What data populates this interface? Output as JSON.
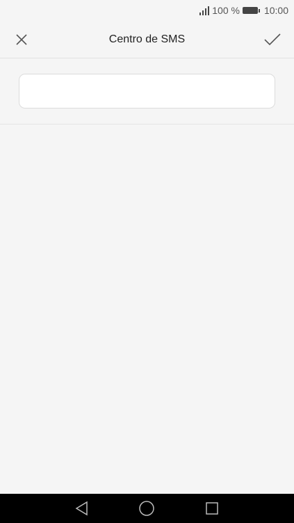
{
  "status_bar": {
    "battery_percent": "100 %",
    "time": "10:00",
    "signal_icon": "signal-bars-icon",
    "battery_icon": "battery-full-icon"
  },
  "header": {
    "title": "Centro de SMS",
    "close_icon": "close-icon",
    "confirm_icon": "checkmark-icon"
  },
  "form": {
    "sms_center_value": "",
    "sms_center_placeholder": ""
  },
  "nav_bar": {
    "back_icon": "back-triangle-icon",
    "home_icon": "home-circle-icon",
    "recent_icon": "recent-apps-square-icon"
  },
  "colors": {
    "background": "#f5f5f5",
    "nav_bar": "#000000",
    "text": "#222222"
  }
}
